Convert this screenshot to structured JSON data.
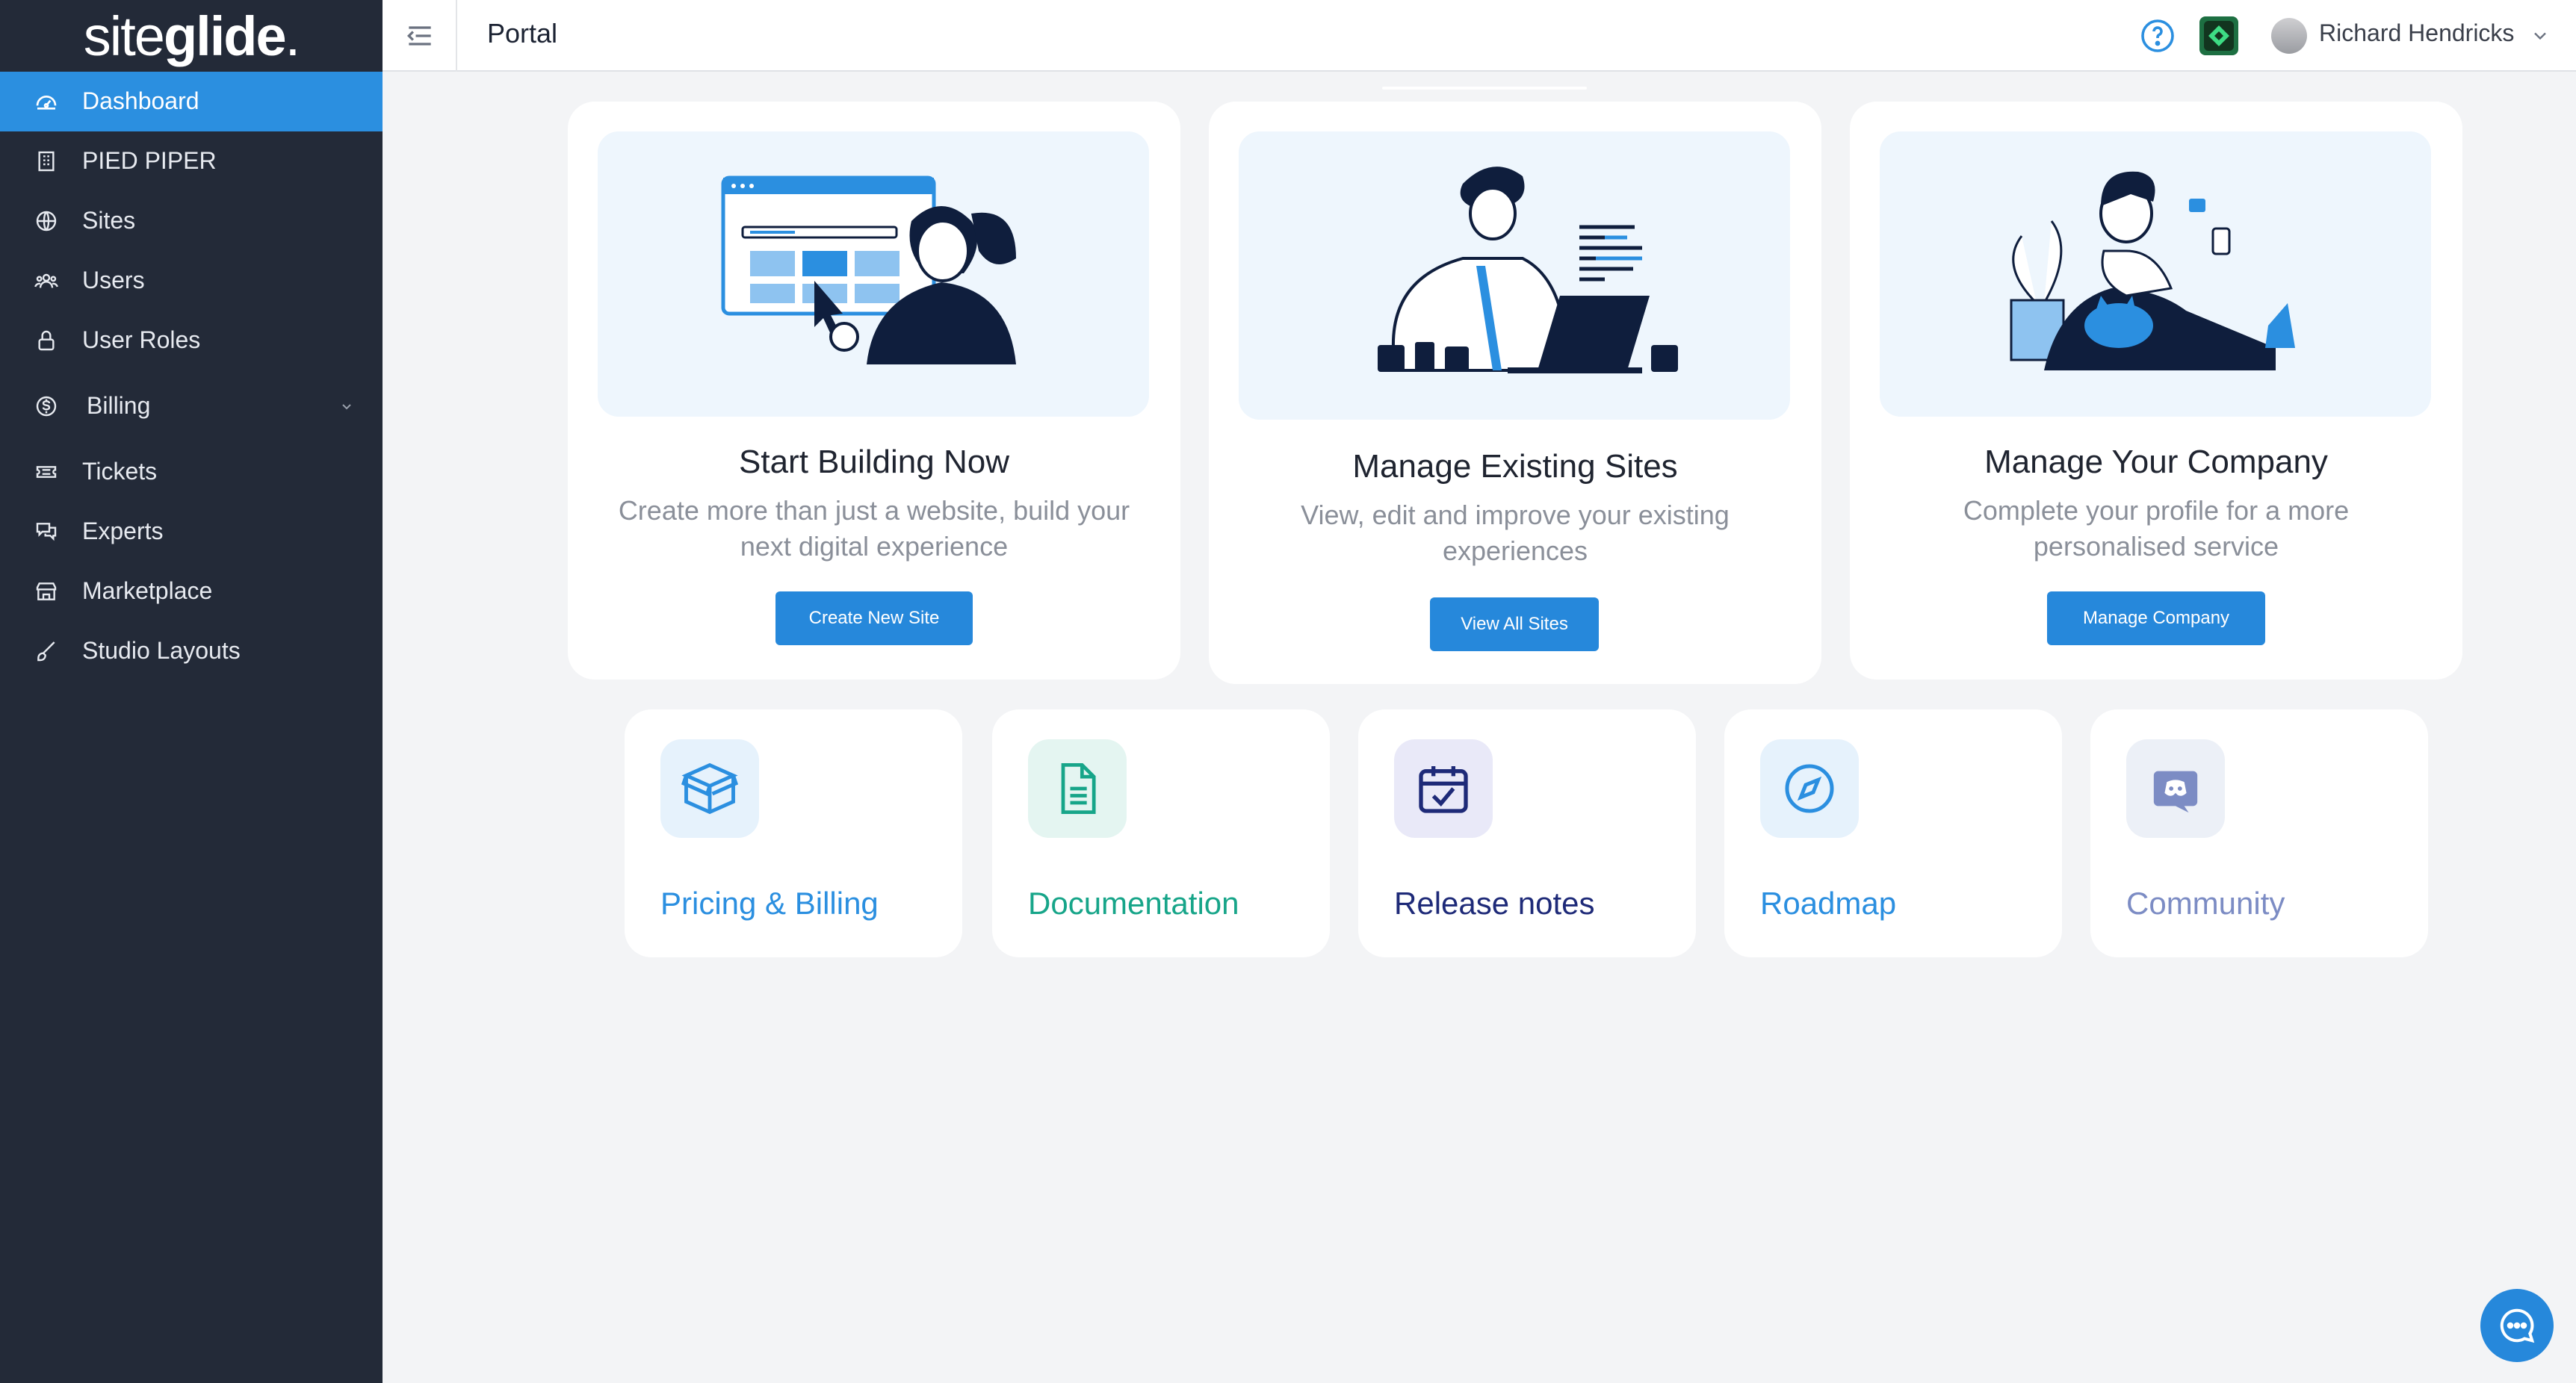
{
  "app": {
    "logo_text_light": "site",
    "logo_text_bold": "glide",
    "logo_dot": ".",
    "page_title": "Portal"
  },
  "sidebar": {
    "items": [
      {
        "label": "Dashboard",
        "icon": "dashboard-icon",
        "active": true
      },
      {
        "label": "PIED PIPER",
        "icon": "building-icon"
      },
      {
        "label": "Sites",
        "icon": "globe-icon"
      },
      {
        "label": "Users",
        "icon": "users-icon"
      },
      {
        "label": "User Roles",
        "icon": "lock-icon"
      },
      {
        "label": "Billing",
        "icon": "dollar-icon",
        "expandable": true
      },
      {
        "label": "Tickets",
        "icon": "ticket-icon"
      },
      {
        "label": "Experts",
        "icon": "chat-bubbles-icon"
      },
      {
        "label": "Marketplace",
        "icon": "store-icon"
      },
      {
        "label": "Studio Layouts",
        "icon": "brush-icon"
      }
    ]
  },
  "header": {
    "user_name": "Richard Hendricks",
    "help_icon": "help-circle-icon",
    "app_icon": "siteglide-app-icon"
  },
  "hero_cards": [
    {
      "title": "Start Building Now",
      "description": "Create more than just a website, build your next digital experience",
      "button": "Create New Site"
    },
    {
      "title": "Manage Existing Sites",
      "description": "View, edit and improve your existing experiences",
      "button": "View All Sites"
    },
    {
      "title": "Manage Your Company",
      "description": "Complete your profile for a more personalised service",
      "button": "Manage Company"
    }
  ],
  "quick_links": [
    {
      "label": "Pricing & Billing",
      "icon": "box-icon",
      "color": "#2b8fe0"
    },
    {
      "label": "Documentation",
      "icon": "document-icon",
      "color": "#17a589"
    },
    {
      "label": "Release notes",
      "icon": "calendar-check-icon",
      "color": "#1e2a78"
    },
    {
      "label": "Roadmap",
      "icon": "compass-icon",
      "color": "#2b8fe0"
    },
    {
      "label": "Community",
      "icon": "discord-icon",
      "color": "#7c8cc4"
    }
  ],
  "colors": {
    "sidebar_bg": "#232a38",
    "accent": "#2b8fe0",
    "button": "#2688db"
  }
}
